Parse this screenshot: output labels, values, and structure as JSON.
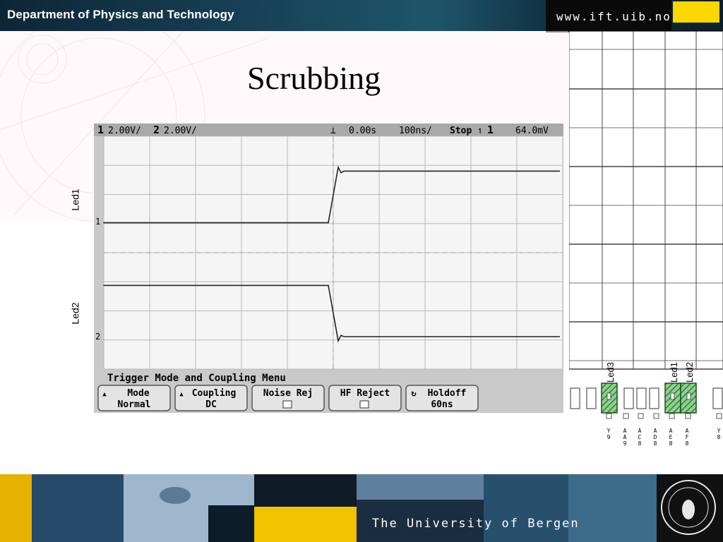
{
  "header": {
    "department": "Department of Physics and Technology",
    "url": "www.ift.uib.no"
  },
  "slide": {
    "title": "Scrubbing"
  },
  "side_labels": {
    "led1": "Led1",
    "led2": "Led2"
  },
  "scope": {
    "status": {
      "ch1_num": "1",
      "ch1_scale": "2.00V/",
      "ch2_num": "2",
      "ch2_scale": "2.00V/",
      "time_offset": "0.00s",
      "time_scale": "100ns/",
      "run_state": "Stop",
      "trigger_channel": "1",
      "trigger_level": "64.0mV"
    },
    "menu_title": "Trigger Mode and Coupling Menu",
    "softkeys": {
      "mode_label": "Mode",
      "mode_value": "Normal",
      "coupling_label": "Coupling",
      "coupling_value": "DC",
      "noise_rej_label": "Noise Rej",
      "hf_reject_label": "HF Reject",
      "holdoff_label": "Holdoff",
      "holdoff_value": "60ns"
    },
    "traces": [
      {
        "name": "Led1",
        "initial_level": "low",
        "final_level": "high"
      },
      {
        "name": "Led2",
        "initial_level": "high",
        "final_level": "low"
      }
    ]
  },
  "chip": {
    "labels": {
      "led3": "Led3",
      "led1": "Led1",
      "led2": "Led2"
    },
    "pins": [
      {
        "lines": [
          "Y",
          "9"
        ]
      },
      {
        "lines": [
          "A",
          "A",
          "9"
        ]
      },
      {
        "lines": [
          "A",
          "C",
          "8"
        ]
      },
      {
        "lines": [
          "A",
          "D",
          "8"
        ]
      },
      {
        "lines": [
          "A",
          "E",
          "8"
        ]
      },
      {
        "lines": [
          "A",
          "F",
          "8"
        ]
      },
      {
        "lines": [
          "Y",
          "8"
        ]
      }
    ],
    "colors": {
      "highlight": "#2f7d3a"
    }
  },
  "footer": {
    "university": "The University of Bergen"
  }
}
